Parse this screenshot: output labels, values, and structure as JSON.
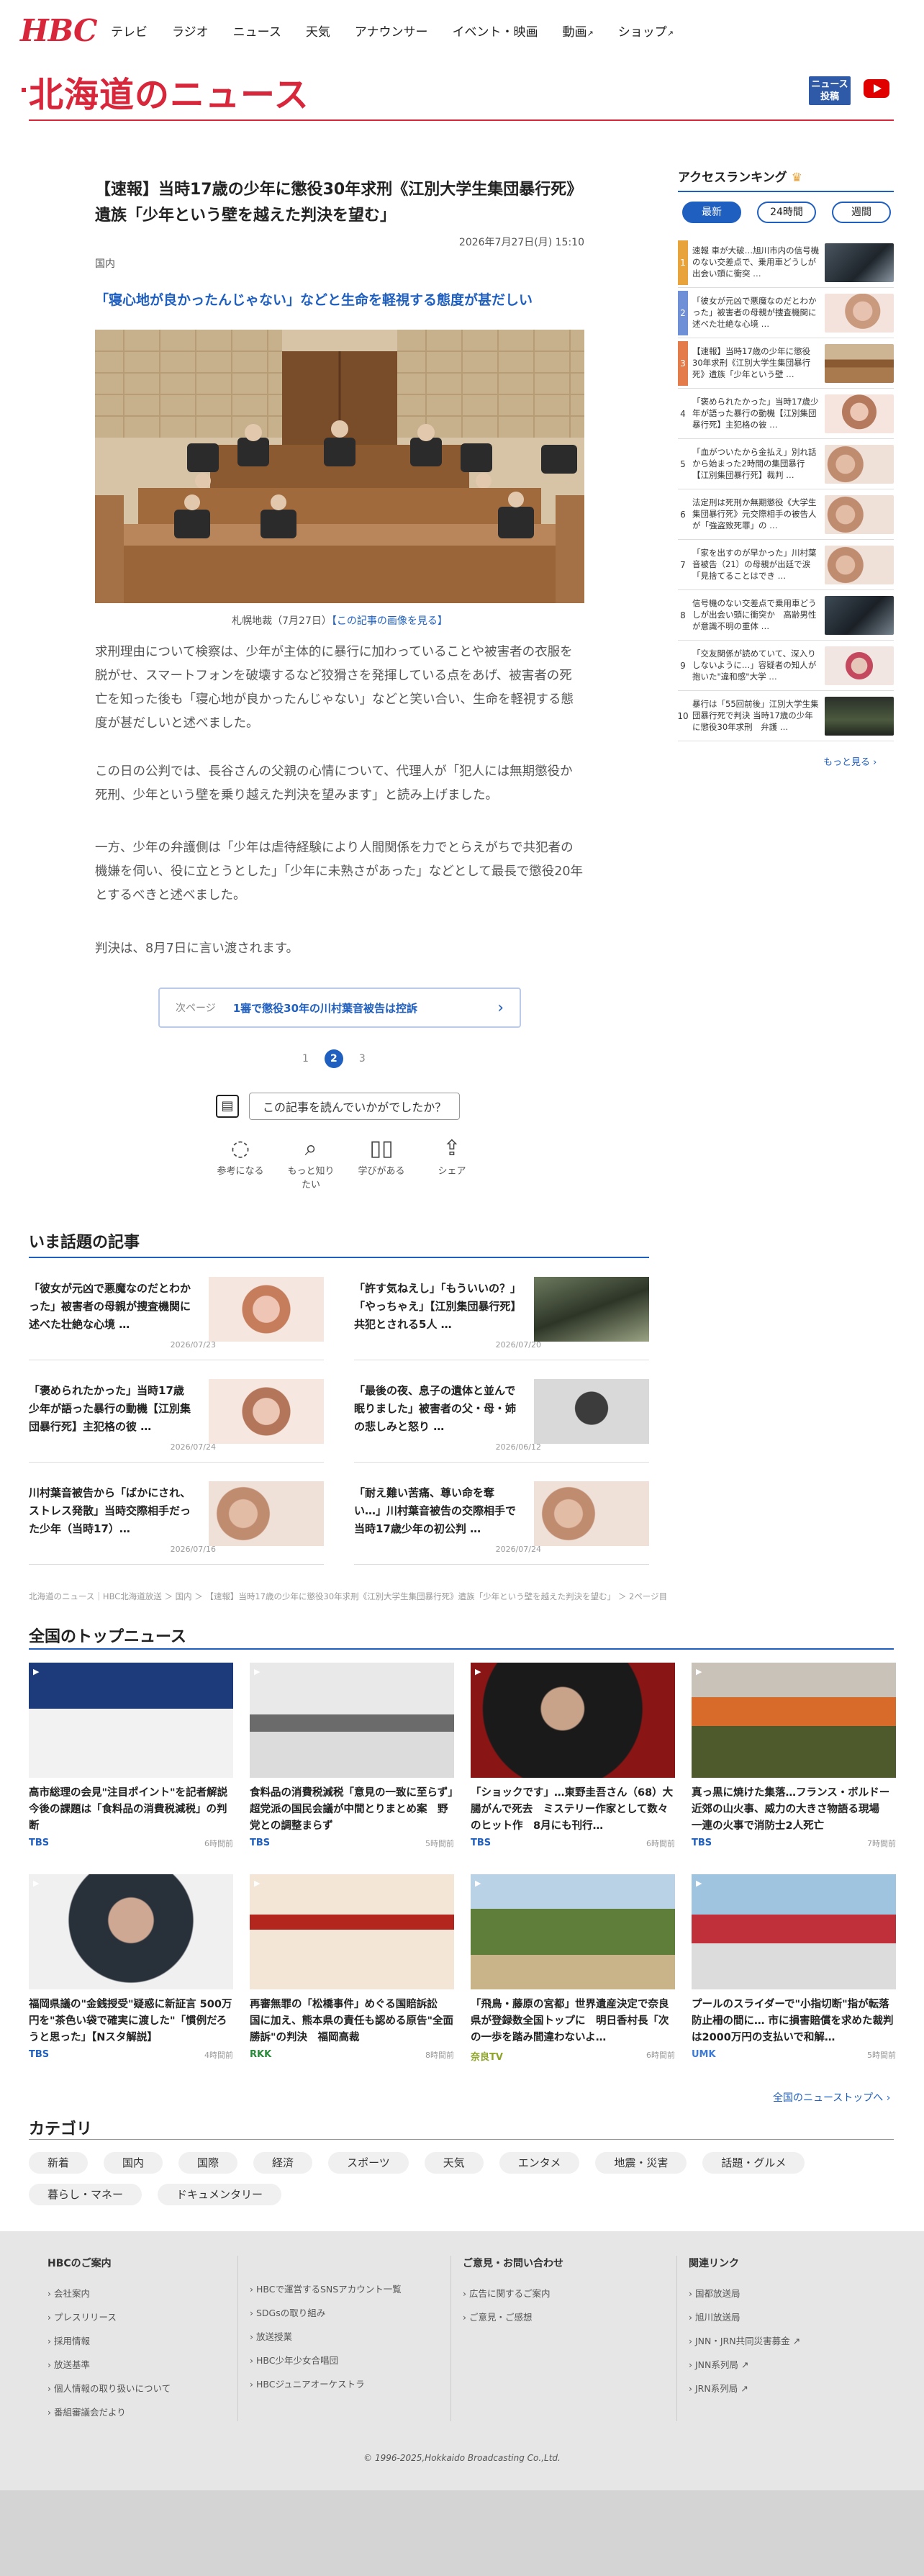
{
  "header": {
    "logo": "HBC",
    "nav": [
      "テレビ",
      "ラジオ",
      "ニュース",
      "天気",
      "アナウンサー",
      "イベント・映画",
      "動画",
      "ショップ"
    ],
    "section_title": "北海道のニュース",
    "post_button": "ニュース 投稿"
  },
  "article": {
    "title": "【速報】当時17歳の少年に懲役30年求刑《江別大学生集団暴行死》遺族「少年という壁を越えた判決を望む」",
    "date": "2026年7月27日(月) 15:10",
    "category": "国内",
    "lead": "「寝心地が良かったんじゃない」などと生命を軽視する態度が甚だしい",
    "caption_prefix": "札幌地裁（7月27日）",
    "caption_link": "【この記事の画像を見る】",
    "paragraphs": [
      "求刑理由について検察は、少年が主体的に暴行に加わっていることや被害者の衣服を脱がせ、スマートフォンを破壊するなど狡猾さを発揮している点をあげ、被害者の死亡を知った後も「寝心地が良かったんじゃない」などと笑い合い、生命を軽視する態度が甚だしいと述べました。",
      "この日の公判では、長谷さんの父親の心情について、代理人が「犯人には無期懲役か死刑、少年という壁を乗り越えた判決を望みます」と読み上げました。",
      "一方、少年の弁護側は「少年は虐待経験により人間関係を力でとらえがちで共犯者の機嫌を伺い、役に立とうとした」「少年に未熟さがあった」などとして最長で懲役20年とするべきと述べました。",
      "判決は、8月7日に言い渡されます。"
    ],
    "prev_label": "次ページ",
    "prev_title": "1審で懲役30年の川村葉音被告は控訴",
    "pages": [
      "1",
      "2",
      "3"
    ],
    "feedback_question": "この記事を読んでいかがでしたか？",
    "actions": [
      "参考になる",
      "もっと知りたい",
      "学びがある",
      "シェア"
    ]
  },
  "ranking": {
    "title": "アクセスランキング",
    "tabs": [
      "最新",
      "24時間",
      "週間"
    ],
    "items": [
      {
        "n": "1",
        "text": "速報 車が大破…旭川市内の信号機のない交差点で、乗用車どうしが出会い頭に衝突 …"
      },
      {
        "n": "2",
        "text": "「彼女が元凶で悪魔なのだとわかった」被害者の母親が捜査機関に述べた壮絶な心境 …"
      },
      {
        "n": "3",
        "text": "【速報】当時17歳の少年に懲役30年求刑《江別大学生集団暴行死》遺族「少年という壁 …"
      },
      {
        "n": "4",
        "text": "「褒められたかった」当時17歳少年が語った暴行の動機【江別集団暴行死】主犯格の彼 …"
      },
      {
        "n": "5",
        "text": "「血がついたから金払え」別れ話から始まった2時間の集団暴行【江別集団暴行死】裁判 …"
      },
      {
        "n": "6",
        "text": "法定刑は死刑か無期懲役《大学生集団暴行死》元交際相手の被告人が「強盗致死罪」の …"
      },
      {
        "n": "7",
        "text": "「家を出すのが早かった」川村葉音被告（21）の母親が出廷で涙「見捨てることはでき …"
      },
      {
        "n": "8",
        "text": "信号機のない交差点で乗用車どうしが出会い頭に衝突か　高齢男性が意識不明の重体 …"
      },
      {
        "n": "9",
        "text": "「交友関係が読めていて、深入りしないように…」容疑者の知人が抱いた\"違和感\"大学 …"
      },
      {
        "n": "10",
        "text": "暴行は「55回前後」江別大学生集団暴行死で判決 当時17歳の少年に懲役30年求刑　弁護 …"
      }
    ],
    "more": "もっと見る"
  },
  "trending": {
    "title": "いま話題の記事",
    "items": [
      {
        "title": "「彼女が元凶で悪魔なのだとわかった」被害者の母親が捜査機関に述べた壮絶な心境 …",
        "date": "2026/07/23"
      },
      {
        "title": "「許す気ねえし」「もういいの？」「やっちゃえ」【江別集団暴行死】共犯とされる5人 …",
        "date": "2026/07/20"
      },
      {
        "title": "「褒められたかった」当時17歳少年が語った暴行の動機【江別集団暴行死】主犯格の彼 …",
        "date": "2026/07/24"
      },
      {
        "title": "「最後の夜、息子の遺体と並んで眠りました」被害者の父・母・姉の悲しみと怒り …",
        "date": "2026/06/12"
      },
      {
        "title": "川村葉音被告から「ばかにされ、ストレス発散」当時交際相手だった少年（当時17）…",
        "date": "2026/07/16"
      },
      {
        "title": "「耐え難い苦痛、尊い命を奪い…」川村葉音被告の交際相手で当時17歳少年の初公判 …",
        "date": "2026/07/24"
      }
    ]
  },
  "breadcrumb": "北海道のニュース｜HBC北海道放送 ＞ 国内 ＞ 【速報】当時17歳の少年に懲役30年求刑《江別大学生集団暴行死》遺族「少年という壁を越えた判決を望む」 ＞ 2ページ目",
  "national": {
    "title": "全国のトップニュース",
    "items": [
      {
        "title": "高市総理の会見\"注目ポイント\"を記者解説　今後の課題は「食料品の消費税減税」の判断",
        "source": "TBS",
        "time": "6時間前"
      },
      {
        "title": "食料品の消費税減税「意見の一致に至らず」超党派の国民会議が中間とりまとめ案　野党との調整まらず",
        "source": "TBS",
        "time": "5時間前"
      },
      {
        "title": "「ショックです」…東野圭吾さん（68）大腸がんで死去　ミステリー作家として数々のヒット作　8月にも刊行…",
        "source": "TBS",
        "time": "6時間前"
      },
      {
        "title": "真っ黒に焼けた集落…フランス・ボルドー近郊の山火事、威力の大きさ物語る現場　一連の火事で消防士2人死亡",
        "source": "TBS",
        "time": "7時間前"
      },
      {
        "title": "福岡県議の\"金銭授受\"疑惑に新証言 500万円を\"茶色い袋で確実に渡した\"「慣例だろうと思った」【Nスタ解説】",
        "source": "TBS",
        "time": "4時間前"
      },
      {
        "title": "再審無罪の「松橋事件」めぐる国賠訴訟　国に加え、熊本県の責任も認める原告\"全面勝訴\"の判決　福岡高裁",
        "source": "RKK",
        "time": "8時間前"
      },
      {
        "title": "「飛鳥・藤原の宮都」世界遺産決定で奈良県が登録数全国トップに　明日香村長「次の一歩を踏み間違わないよ…",
        "source": "奈良TV",
        "time": "6時間前"
      },
      {
        "title": "プールのスライダーで\"小指切断\"指が転落防止柵の間に… 市に損害賠償を求めた裁判は2000万円の支払いで和解…",
        "source": "UMK",
        "time": "5時間前"
      }
    ],
    "all_link": "全国のニューストップへ ›"
  },
  "categories": {
    "title": "カテゴリ",
    "items": [
      "新着",
      "国内",
      "国際",
      "経済",
      "スポーツ",
      "天気",
      "エンタメ",
      "地震・災害",
      "話題・グルメ",
      "暮らし・マネー",
      "ドキュメンタリー"
    ]
  },
  "footer": {
    "col1_title": "HBCのご案内",
    "col1": [
      "会社案内",
      "プレスリリース",
      "採用情報",
      "放送基準",
      "個人情報の取り扱いについて",
      "番組審議会だより"
    ],
    "col2": [
      "HBCで運営するSNSアカウント一覧",
      "SDGsの取り組み",
      "放送授業",
      "HBC少年少女合唱団",
      "HBCジュニアオーケストラ"
    ],
    "col3_title": "ご意見・お問い合わせ",
    "col3": [
      "広告に関するご案内",
      "ご意見・ご感想"
    ],
    "col4_title": "関連リンク",
    "col4": [
      "国都放送局",
      "旭川放送局",
      "JNN・JRN共同災害募金",
      "JNN系列局",
      "JRN系列局"
    ],
    "copyright": "© 1996-2025,Hokkaido Broadcasting Co.,Ltd."
  },
  "colors": {
    "brand": "#d8263b",
    "accent": "#1f5fbf"
  }
}
